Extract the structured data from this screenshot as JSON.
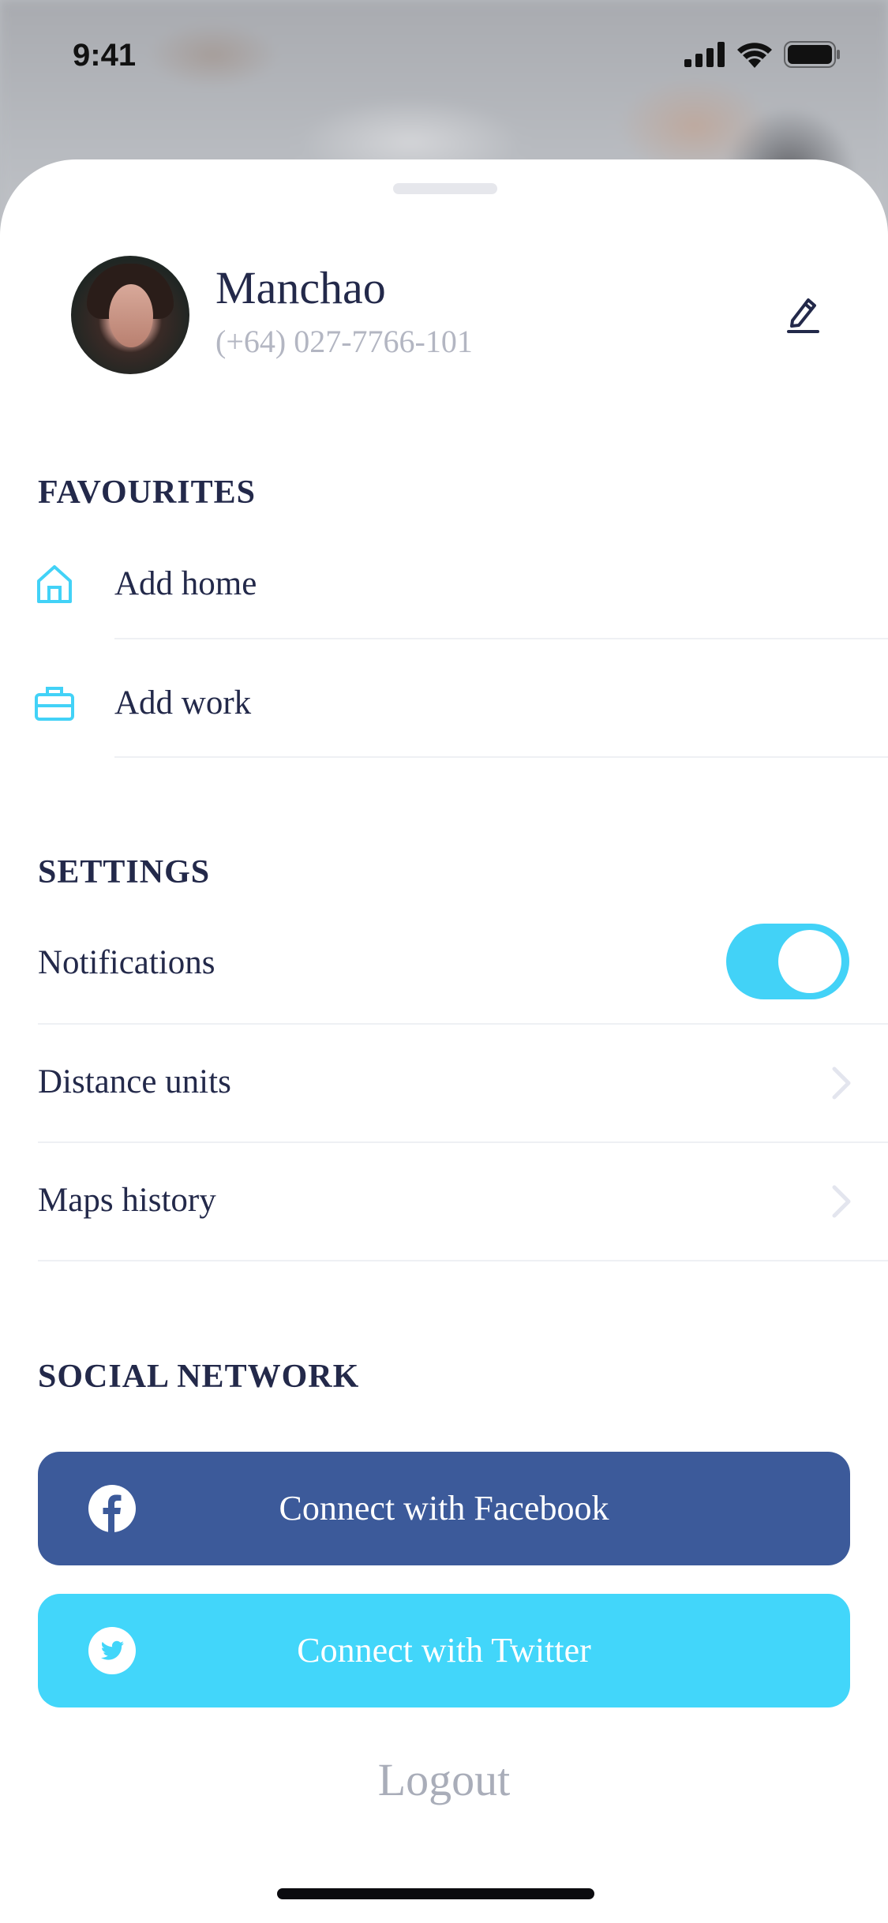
{
  "status_bar": {
    "time": "9:41",
    "icons": [
      "cellular-signal-icon",
      "wifi-icon",
      "battery-icon"
    ]
  },
  "profile": {
    "name": "Manchao",
    "phone": "(+64) 027-7766-101",
    "edit_icon": "edit-pencil-icon"
  },
  "favourites": {
    "title": "FAVOURITES",
    "items": [
      {
        "label": "Add home",
        "icon": "home-icon"
      },
      {
        "label": "Add work",
        "icon": "briefcase-icon"
      }
    ]
  },
  "settings": {
    "title": "SETTINGS",
    "items": [
      {
        "label": "Notifications",
        "control": "toggle",
        "value": "on"
      },
      {
        "label": "Distance units",
        "control": "chevron"
      },
      {
        "label": "Maps history",
        "control": "chevron"
      }
    ]
  },
  "social": {
    "title": "SOCIAL NETWORK",
    "facebook_label": "Connect with Facebook",
    "twitter_label": "Connect with Twitter"
  },
  "logout_label": "Logout",
  "colors": {
    "accent": "#42d2f7",
    "text_primary": "#23294a",
    "text_secondary": "#b3b6c2",
    "facebook": "#3c5a9a",
    "twitter": "#42d6fa"
  }
}
